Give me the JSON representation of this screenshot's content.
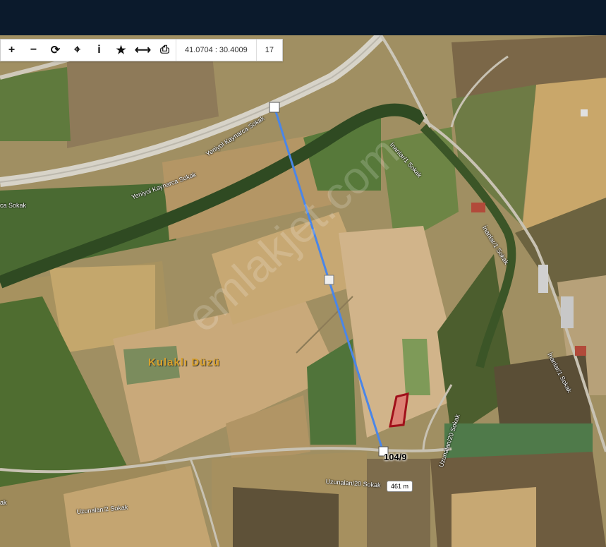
{
  "toolbar": {
    "tools": [
      {
        "icon": "zoom-in-icon",
        "glyph": "+"
      },
      {
        "icon": "zoom-out-icon",
        "glyph": "−"
      },
      {
        "icon": "refresh-icon",
        "glyph": "⟳"
      },
      {
        "icon": "locate-icon",
        "glyph": "⌖"
      },
      {
        "icon": "info-icon",
        "glyph": "i"
      },
      {
        "icon": "star-icon",
        "glyph": "★"
      },
      {
        "icon": "measure-icon",
        "glyph": "⟷"
      },
      {
        "icon": "print-icon",
        "glyph": "⎙"
      }
    ],
    "coordinates": "41.0704 : 30.4009",
    "zoom_level": "17"
  },
  "map": {
    "place_name": "Kulaklı Düzü",
    "parcel_label": "104/9",
    "distance_label": "461 m",
    "watermark": "emlakjet.com",
    "roads": {
      "r1": "Yeniyol Kaynarca Sokak",
      "r2": "Yeniyol Kaynarca Sokak",
      "r3": "ca Sokak",
      "r4": "İnanlar/1 Sokak",
      "r5": "İnanlar/1 Sokak",
      "r6": "İnanlar/1 Sokak",
      "r7": "Uzunalan/20 Sokak",
      "r8": "Uzunalan/20 Sokak",
      "r9": "Uzunalan/2 Sokak",
      "r10": "ak"
    },
    "colors": {
      "measure_line": "#4a86e8",
      "parcel_fill": "#e36b6b",
      "parcel_border": "#a0101a"
    }
  }
}
